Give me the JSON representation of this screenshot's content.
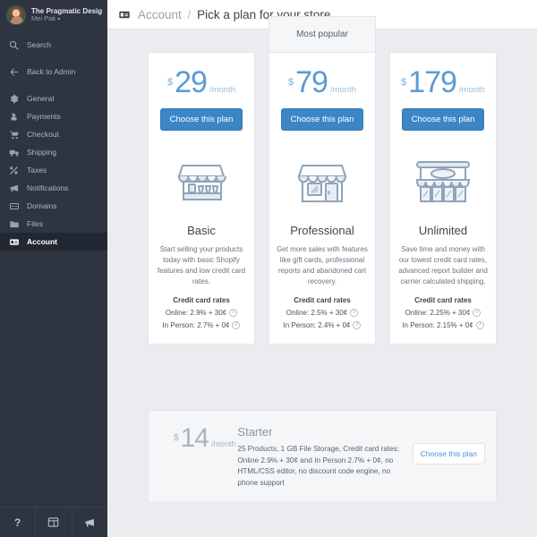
{
  "sidebar": {
    "user": {
      "name": "The Pragmatic Desig...",
      "sub": "Mei Pak",
      "caret": "▾",
      "avatar_icon": "avatar"
    },
    "search": {
      "label": "Search",
      "icon": "search-icon"
    },
    "back": {
      "label": "Back to Admin",
      "icon": "arrow-left-icon"
    },
    "items": [
      {
        "label": "General",
        "icon": "gear-icon",
        "active": false
      },
      {
        "label": "Payments",
        "icon": "payment-icon",
        "active": false
      },
      {
        "label": "Checkout",
        "icon": "cart-icon",
        "active": false
      },
      {
        "label": "Shipping",
        "icon": "truck-icon",
        "active": false
      },
      {
        "label": "Taxes",
        "icon": "percent-icon",
        "active": false
      },
      {
        "label": "Notifications",
        "icon": "megaphone-icon",
        "active": false
      },
      {
        "label": "Domains",
        "icon": "domain-icon",
        "active": false
      },
      {
        "label": "Files",
        "icon": "folder-icon",
        "active": false
      },
      {
        "label": "Account",
        "icon": "id-card-icon",
        "active": true
      }
    ],
    "footer": [
      {
        "icon": "help-icon",
        "glyph": "?"
      },
      {
        "icon": "layout-panel-icon",
        "glyph": ""
      },
      {
        "icon": "megaphone-icon",
        "glyph": ""
      }
    ]
  },
  "header": {
    "icon": "id-card-icon",
    "breadcrumb_root": "Account",
    "breadcrumb_sep": "/",
    "breadcrumb_current": "Pick a plan for your store"
  },
  "popular_badge": "Most popular",
  "plans": [
    {
      "name": "Basic",
      "currency": "$",
      "price": "29",
      "period": "/month",
      "cta": "Choose this plan",
      "illustration": "market-stall-icon",
      "description": "Start selling your products today with basic Shopify features and low credit card rates.",
      "rates_title": "Credit card rates",
      "rate_online": "Online: 2.9% + 30¢",
      "rate_in_person": "In Person: 2.7% + 0¢",
      "popular": false
    },
    {
      "name": "Professional",
      "currency": "$",
      "price": "79",
      "period": "/month",
      "cta": "Choose this plan",
      "illustration": "shop-front-icon",
      "description": "Get more sales with features like gift cards, professional reports and abandoned cart recovery.",
      "rates_title": "Credit card rates",
      "rate_online": "Online: 2.5% + 30¢",
      "rate_in_person": "In Person: 2.4% + 0¢",
      "popular": true
    },
    {
      "name": "Unlimited",
      "currency": "$",
      "price": "179",
      "period": "/month",
      "cta": "Choose this plan",
      "illustration": "mall-front-icon",
      "description": "Save time and money with our lowest credit card rates, advanced report builder and carrier calculated shipping.",
      "rates_title": "Credit card rates",
      "rate_online": "Online: 2.25% + 30¢",
      "rate_in_person": "In Person: 2.15% + 0¢",
      "popular": false
    }
  ],
  "starter": {
    "currency": "$",
    "price": "14",
    "period": "/month",
    "title": "Starter",
    "description": "25 Products, 1 GB File Storage, Credit card rates: Online 2.9% + 30¢ and In Person 2.7% + 0¢, no HTML/CSS editor, no discount code engine, no phone support",
    "cta": "Choose this plan"
  },
  "info_glyph": "i",
  "colors": {
    "sidebar_bg": "#2e3440",
    "sidebar_active": "#222831",
    "page_bg": "#eaecef",
    "accent_blue": "#3d86c6",
    "price_blue": "#5b9bd5",
    "illustration": "#8ea4bb"
  }
}
